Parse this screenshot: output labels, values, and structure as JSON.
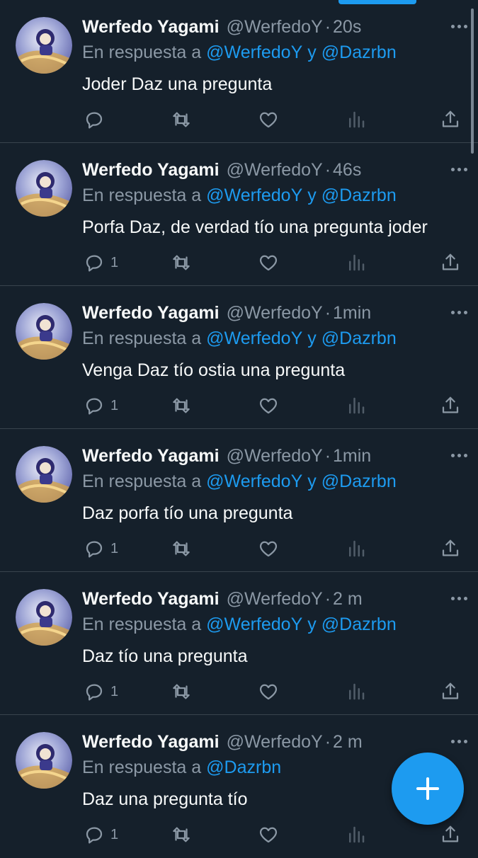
{
  "colors": {
    "background": "#15202b",
    "accent": "#1d9bf0",
    "muted": "#8b98a5",
    "text": "#f7f9f9",
    "divider": "#38444d"
  },
  "reply_prefix": "En respuesta a",
  "tweets": [
    {
      "name": "Werfedo Yagami",
      "handle": "@WerfedoY",
      "time": "20s",
      "mentions": [
        "@WerfedoY",
        "y",
        "@Dazrbn"
      ],
      "text": "Joder Daz una pregunta",
      "reply_count": ""
    },
    {
      "name": "Werfedo Yagami",
      "handle": "@WerfedoY",
      "time": "46s",
      "mentions": [
        "@WerfedoY",
        "y",
        "@Dazrbn"
      ],
      "text": "Porfa Daz, de verdad tío una pregunta joder",
      "reply_count": "1"
    },
    {
      "name": "Werfedo Yagami",
      "handle": "@WerfedoY",
      "time": "1min",
      "mentions": [
        "@WerfedoY",
        "y",
        "@Dazrbn"
      ],
      "text": "Venga Daz tío ostia una pregunta",
      "reply_count": "1"
    },
    {
      "name": "Werfedo Yagami",
      "handle": "@WerfedoY",
      "time": "1min",
      "mentions": [
        "@WerfedoY",
        "y",
        "@Dazrbn"
      ],
      "text": "Daz porfa tío una pregunta",
      "reply_count": "1"
    },
    {
      "name": "Werfedo Yagami",
      "handle": "@WerfedoY",
      "time": "2 m",
      "mentions": [
        "@WerfedoY",
        "y",
        "@Dazrbn"
      ],
      "text": "Daz tío una pregunta",
      "reply_count": "1"
    },
    {
      "name": "Werfedo Yagami",
      "handle": "@WerfedoY",
      "time": "2 m",
      "mentions": [
        "@Dazrbn"
      ],
      "text": "Daz una pregunta tío",
      "reply_count": "1"
    }
  ],
  "icons": {
    "reply": "reply-icon",
    "retweet": "retweet-icon",
    "like": "like-icon",
    "views": "views-icon",
    "share": "share-icon",
    "more": "more-icon",
    "compose": "plus-icon"
  }
}
